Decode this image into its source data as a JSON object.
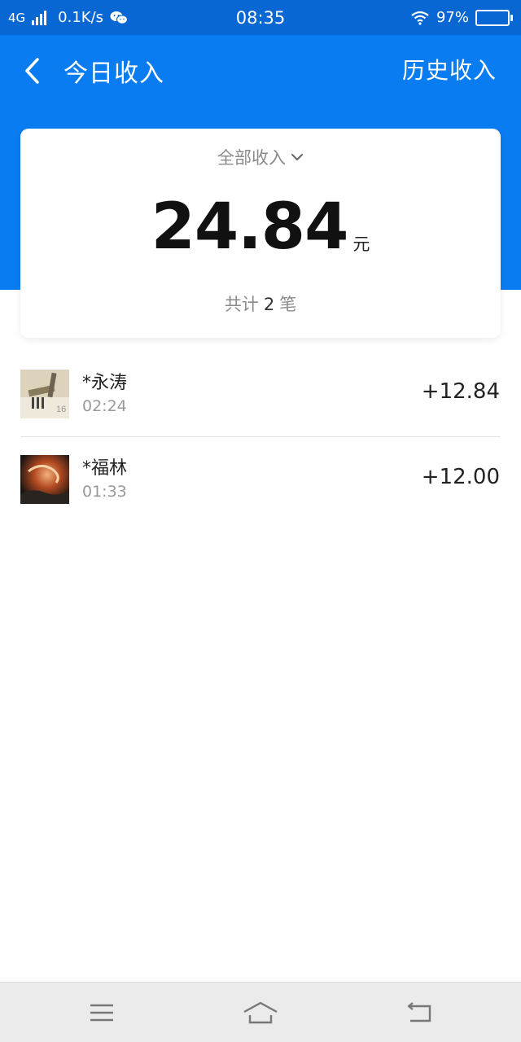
{
  "status_bar": {
    "network": "4G",
    "speed": "0.1K/s",
    "time": "08:35",
    "battery": "97%",
    "battery_level": 0.97,
    "icons": [
      "signal-icon",
      "wechat-icon",
      "wifi-icon",
      "battery-icon"
    ]
  },
  "header": {
    "title": "今日收入",
    "history_label": "历史收入",
    "background_color": "#0a7cf2"
  },
  "summary": {
    "filter_label": "全部收入",
    "amount": "24.84",
    "unit": "元",
    "count_prefix": "共计",
    "count": "2",
    "count_suffix": "笔"
  },
  "transactions": [
    {
      "name": "*永涛",
      "time": "02:24",
      "amount": "+12.84"
    },
    {
      "name": "*福林",
      "time": "01:33",
      "amount": "+12.00"
    }
  ],
  "nav_bar": {
    "icons": [
      "menu-icon",
      "home-icon",
      "back-icon"
    ]
  }
}
